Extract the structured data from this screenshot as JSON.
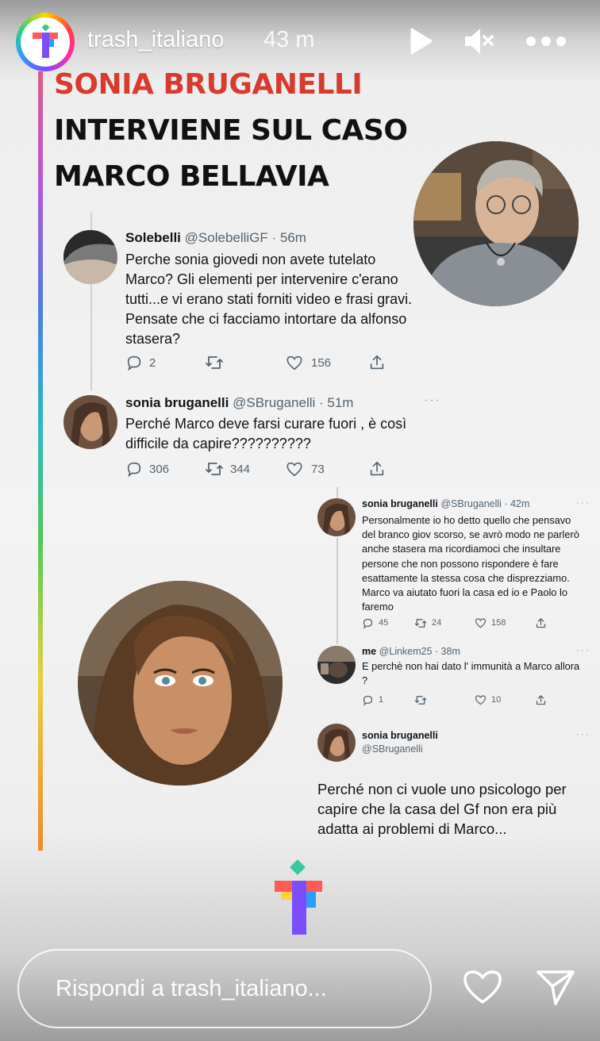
{
  "story": {
    "username": "trash_italiano",
    "time_ago": "43 m",
    "avatar_letter": "T"
  },
  "headline": {
    "line1": "SONIA BRUGANELLI",
    "line2": "INTERVIENE SUL CASO",
    "line3": "MARCO BELLAVIA",
    "line1_color": "#d83a2f",
    "text_color": "#111111"
  },
  "tweets": {
    "t1": {
      "name": "Solebelli",
      "handle": "@SolebelliGF · 56m",
      "text": "Perche sonia giovedi non avete tutelato Marco? Gli elementi per intervenire c'erano tutti...e vi erano stati forniti video e frasi gravi. Pensate che ci facciamo intortare da alfonso stasera?",
      "replies": "2",
      "retweets": "",
      "likes": "156"
    },
    "t2": {
      "name": "sonia bruganelli",
      "handle": "@SBruganelli · 51m",
      "dots": "···",
      "text": "Perché Marco deve farsi curare fuori , è così difficile da capire??????????",
      "replies": "306",
      "retweets": "344",
      "likes": "73"
    },
    "t3": {
      "name": "sonia bruganelli",
      "handle": "@SBruganelli · 42m",
      "dots": "···",
      "text": "Personalmente io ho detto quello che pensavo del branco giov scorso, se avrò modo ne parlerò anche stasera ma ricordiamoci che insultare persone che non possono rispondere è fare esattamente la stessa cosa che disprezziamo. Marco va aiutato fuori la casa ed io e Paolo lo faremo",
      "replies": "45",
      "retweets": "24",
      "likes": "158"
    },
    "t4": {
      "name": "me",
      "handle": "@Linkem25 · 38m",
      "dots": "···",
      "text": "E perchè non hai dato l' immunità a Marco allora ?",
      "replies": "1",
      "retweets": "",
      "likes": "10"
    },
    "t5": {
      "name": "sonia bruganelli",
      "handle": "@SBruganelli",
      "dots": "···",
      "text": "Perché non ci vuole uno psicologo per capire che la casa del Gf non era più adatta ai problemi di Marco..."
    }
  },
  "bottom_bar": {
    "reply_placeholder": "Rispondi a trash_italiano..."
  },
  "icons": {
    "play": "play-icon",
    "mute": "speaker-muted-icon",
    "more": "more-icon",
    "reply": "reply-icon",
    "retweet": "retweet-icon",
    "like": "heart-icon",
    "share": "share-icon",
    "send": "send-icon"
  },
  "colors": {
    "twitter_text": "#0f1419",
    "twitter_secondary": "#536471"
  }
}
